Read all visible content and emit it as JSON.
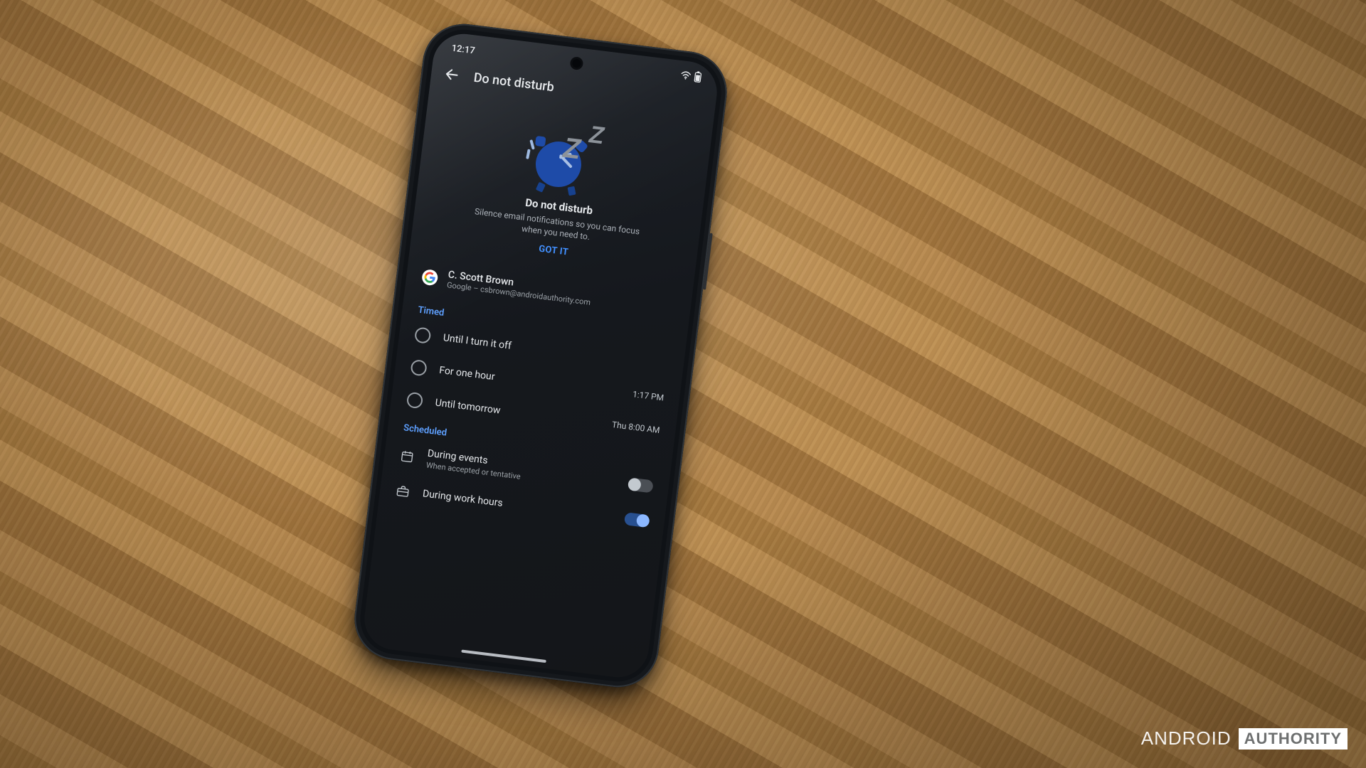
{
  "watermark": {
    "part1": "ANDROID",
    "part2": "AUTHORITY"
  },
  "status": {
    "time": "12:17"
  },
  "header": {
    "title": "Do not disturb"
  },
  "promo": {
    "title": "Do not disturb",
    "subtitle": "Silence email notifications so you can focus when you need to.",
    "cta": "GOT IT"
  },
  "account": {
    "name": "C. Scott Brown",
    "detail": "Google – csbrown@androidauthority.com"
  },
  "sections": {
    "timed": {
      "heading": "Timed",
      "options": [
        {
          "label": "Until I turn it off",
          "aux": ""
        },
        {
          "label": "For one hour",
          "aux": "1:17 PM"
        },
        {
          "label": "Until tomorrow",
          "aux": "Thu 8:00 AM"
        }
      ]
    },
    "scheduled": {
      "heading": "Scheduled",
      "items": [
        {
          "label": "During events",
          "sub": "When accepted or tentative",
          "toggle": false
        },
        {
          "label": "During work hours",
          "sub": "",
          "toggle": true
        }
      ]
    }
  }
}
